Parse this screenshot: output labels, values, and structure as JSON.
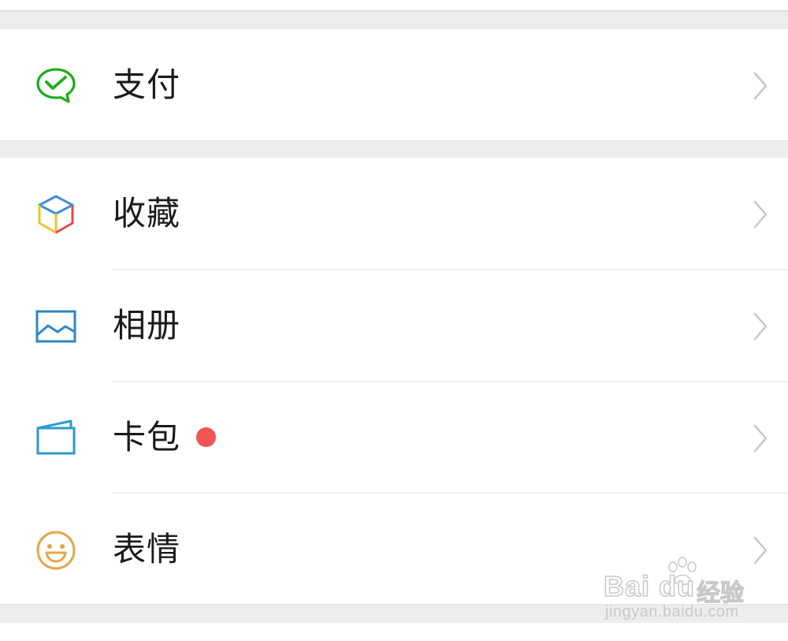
{
  "menu": {
    "items": [
      {
        "label": "支付",
        "icon": "wechat-pay-icon",
        "color": "#1aad19"
      },
      {
        "label": "收藏",
        "icon": "favorites-cube-icon",
        "colors": [
          "#3d8fd8",
          "#f2c12e",
          "#e8484a"
        ]
      },
      {
        "label": "相册",
        "icon": "album-picture-icon",
        "color": "#2d86c6"
      },
      {
        "label": "卡包",
        "icon": "card-wallet-icon",
        "color": "#2d9ad0",
        "badge": "red-dot",
        "badge_color": "#f25452"
      },
      {
        "label": "表情",
        "icon": "sticker-smile-icon",
        "color": "#e6a44a"
      }
    ]
  },
  "watermark": {
    "brand": "Bai du",
    "cn": "经验",
    "url": "jingyan.baidu.com"
  }
}
